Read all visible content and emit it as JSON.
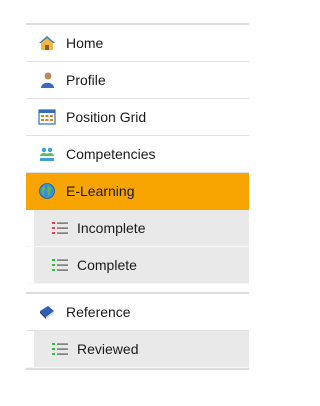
{
  "nav": {
    "items": [
      {
        "label": "Home",
        "icon": "home-icon"
      },
      {
        "label": "Profile",
        "icon": "profile-icon"
      },
      {
        "label": "Position Grid",
        "icon": "grid-icon"
      },
      {
        "label": "Competencies",
        "icon": "competencies-icon"
      },
      {
        "label": "E-Learning",
        "icon": "globe-icon",
        "active": true
      },
      {
        "label": "Incomplete",
        "icon": "list-icon"
      },
      {
        "label": "Complete",
        "icon": "list-icon"
      },
      {
        "label": "Reference",
        "icon": "book-icon"
      },
      {
        "label": "Reviewed",
        "icon": "list-icon"
      }
    ]
  },
  "colors": {
    "active": "#f7a300",
    "sub_bg": "#e9e9e9",
    "incomplete_icon": "#e0405a",
    "complete_icon": "#2fbf3a"
  }
}
